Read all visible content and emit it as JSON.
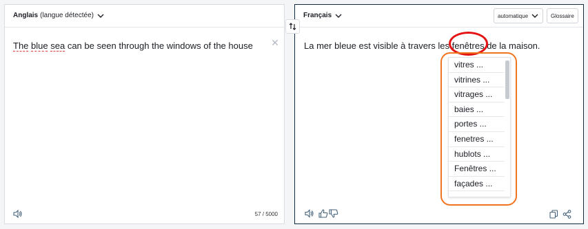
{
  "source": {
    "language": "Anglais",
    "detected_label": "(langue détectée)",
    "text_words": [
      "The",
      "blue",
      "sea",
      "can",
      "be",
      "seen",
      "through",
      "the",
      "windows",
      "of",
      "the",
      "house"
    ],
    "char_count": "57 / 5000"
  },
  "target": {
    "language": "Français",
    "formality": "automatique",
    "glossary": "Glossaire",
    "text_before": "La mer bleue est visible à travers les ",
    "highlighted_word": "fenêtres",
    "text_after": " de la maison.",
    "alternatives": [
      "vitres ...",
      "vitrines ...",
      "vitrages ...",
      "baies ...",
      "portes ...",
      "fenetres ...",
      "hublots ...",
      "Fenêtres ...",
      "façades ..."
    ]
  },
  "annotations": {
    "ellipse_color": "#e41414",
    "rect_color": "#f0731d"
  },
  "icons": [
    "chevron-down-icon",
    "swap-icon",
    "close-icon",
    "speaker-icon",
    "thumbs-up-icon",
    "thumbs-down-icon",
    "copy-icon",
    "share-icon"
  ]
}
